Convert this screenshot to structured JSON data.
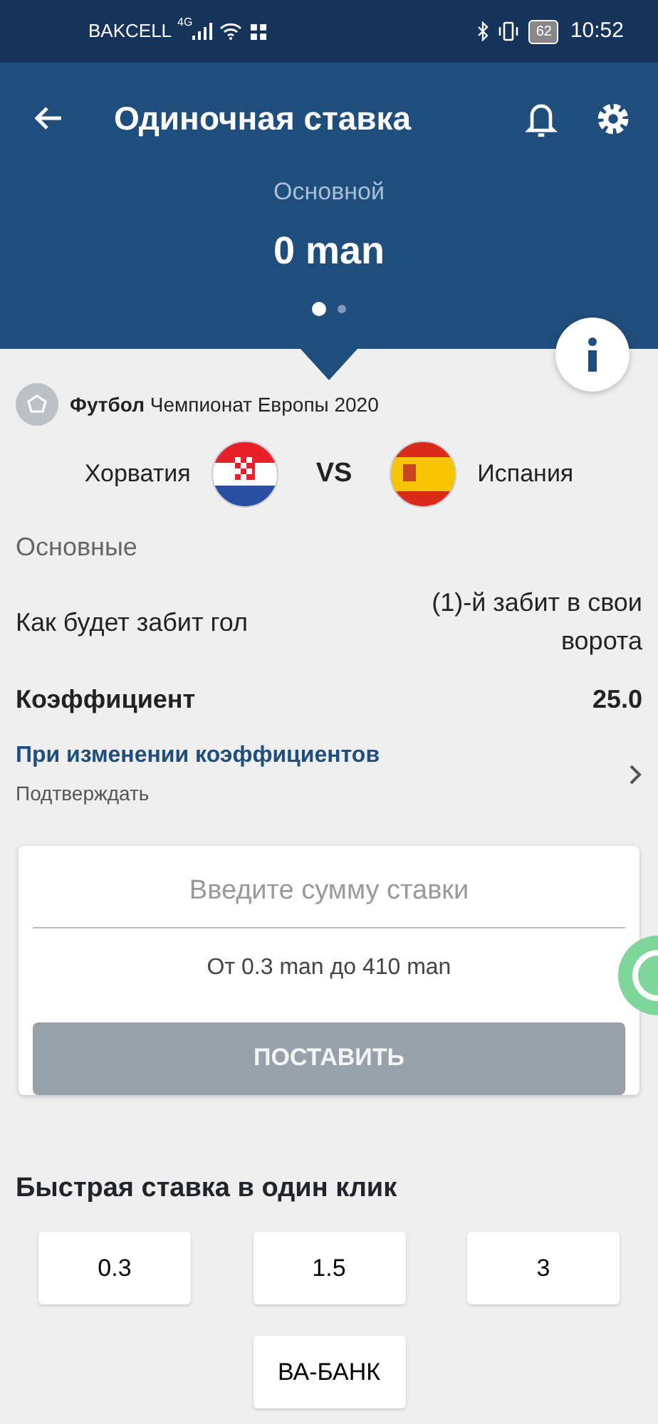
{
  "status_bar": {
    "carrier": "BAKCELL",
    "network": "4G",
    "battery": "62",
    "time": "10:52"
  },
  "header": {
    "title": "Одиночная ставка",
    "balance_label": "Основной",
    "balance": "0 man",
    "pages": [
      {
        "selected": true
      },
      {
        "selected": false
      }
    ]
  },
  "event": {
    "line": "**Футбол** Чемпионат Европы 2020",
    "team_1": "Хорватия",
    "vs": "VS",
    "team_2": "Испания"
  },
  "section": "Основные",
  "rows": [
    {
      "kind": "plain",
      "label": "Как будет забит гол",
      "value": "(1)-й забит в свои ворота"
    },
    {
      "kind": "bold",
      "label": "Коэффициент",
      "value": "25.0"
    }
  ],
  "odds_change": {
    "title": "При изменении коэффициентов",
    "value": "Подтверждать"
  },
  "stake": {
    "placeholder": "Введите сумму ставки",
    "range": "От 0.3 man до 410 man",
    "button": {
      "label": "ПОСТАВИТЬ",
      "disabled": true
    }
  },
  "quick_bet": {
    "title": "Быстрая ставка в один клик",
    "amounts": [
      "0.3",
      "1.5",
      "3",
      "ВА-БАНК"
    ]
  }
}
